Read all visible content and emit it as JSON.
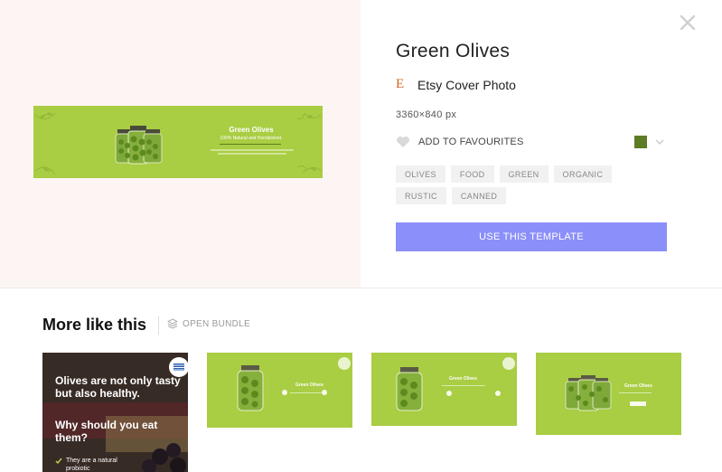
{
  "template": {
    "title": "Green Olives",
    "type_label": "Etsy Cover Photo",
    "type_icon": "E",
    "dimensions": "3360×840 px",
    "favourite_label": "ADD TO FAVOURITES",
    "color_swatch": "#5d7d25",
    "tags": [
      "OLIVES",
      "FOOD",
      "GREEN",
      "ORGANIC",
      "RUSTIC",
      "CANNED"
    ],
    "cta_label": "USE THIS TEMPLATE"
  },
  "preview": {
    "banner_title": "Green Olives",
    "banner_subtitle": "100% Natural and Handpicked.",
    "background": "#a9cd43"
  },
  "more": {
    "title": "More like this",
    "bundle_label": "OPEN BUNDLE",
    "thumbs": [
      {
        "headline1": "Olives are not only tasty but also healthy.",
        "headline2": "Why should you eat them?",
        "bullet": "They are a natural probiotic"
      },
      {
        "title": "Green Olives"
      },
      {
        "title": "Green Olives"
      },
      {
        "title": "Green Olives"
      }
    ]
  },
  "colors": {
    "accent": "#8b8ff9",
    "olive_green": "#a9cd43",
    "preview_bg": "#fcf5f3"
  }
}
